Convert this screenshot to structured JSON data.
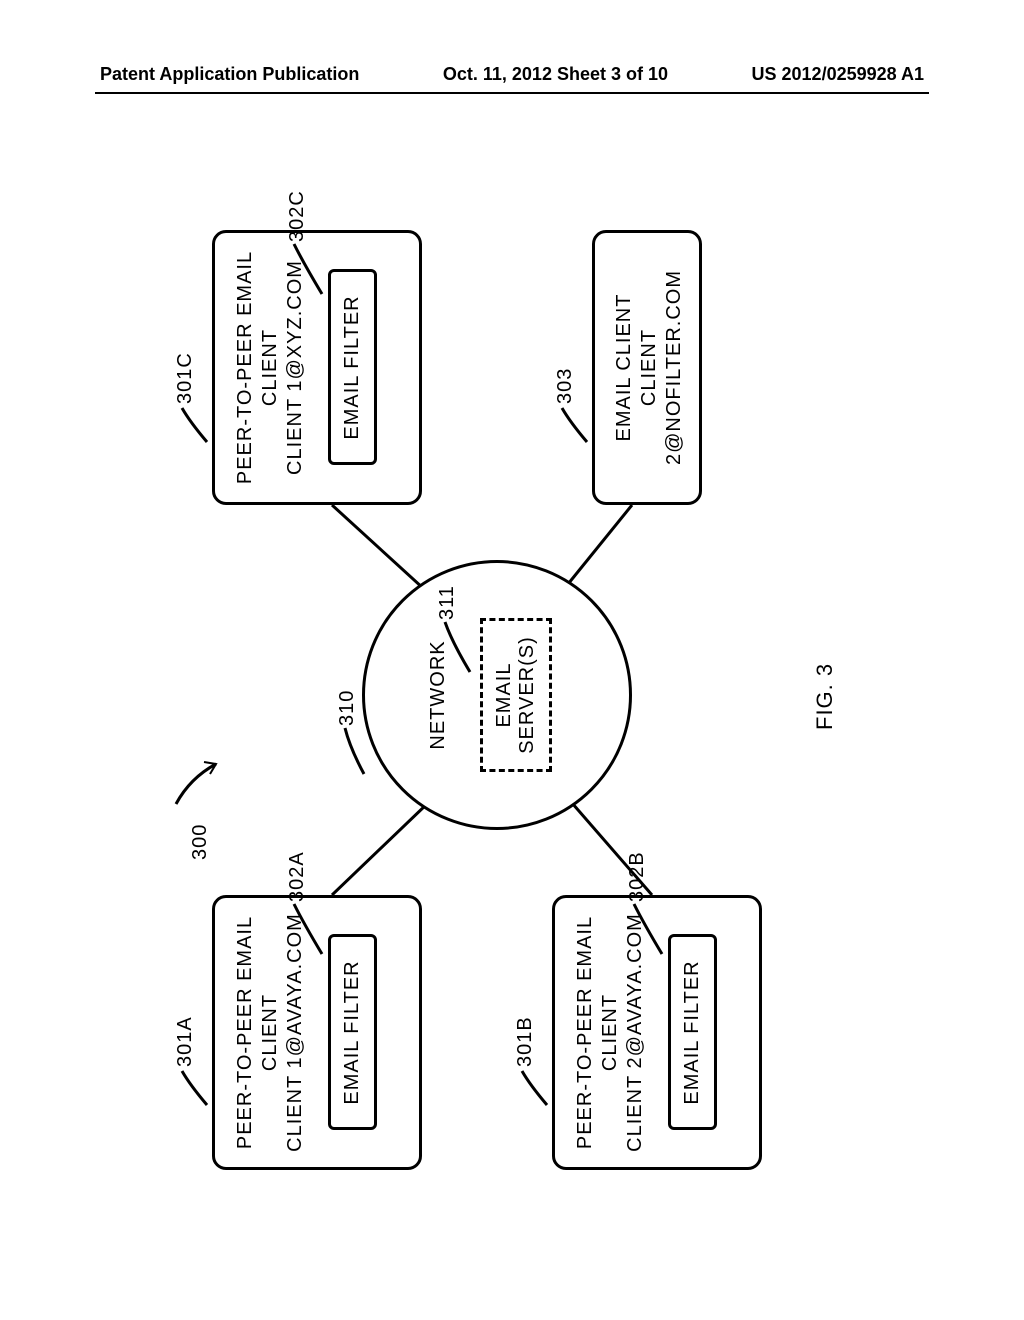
{
  "header": {
    "left": "Patent Application Publication",
    "center": "Oct. 11, 2012  Sheet 3 of 10",
    "right": "US 2012/0259928 A1"
  },
  "figure": {
    "systemRef": "300",
    "networkRef": "310",
    "networkLabel": "NETWORK",
    "serverRef": "311",
    "serverLabel": "EMAIL SERVER(S)",
    "figLabel": "FIG. 3",
    "boxes": {
      "a": {
        "ref": "301A",
        "line1": "PEER-TO-PEER EMAIL",
        "line2": "CLIENT",
        "line3": "CLIENT 1@AVAYA.COM",
        "filterRef": "302A",
        "filterLabel": "EMAIL FILTER"
      },
      "b": {
        "ref": "301B",
        "line1": "PEER-TO-PEER EMAIL",
        "line2": "CLIENT",
        "line3": "CLIENT 2@AVAYA.COM",
        "filterRef": "302B",
        "filterLabel": "EMAIL FILTER"
      },
      "c": {
        "ref": "301C",
        "line1": "PEER-TO-PEER EMAIL",
        "line2": "CLIENT",
        "line3": "CLIENT 1@XYZ.COM",
        "filterRef": "302C",
        "filterLabel": "EMAIL FILTER"
      },
      "d": {
        "ref": "303",
        "line1": "EMAIL CLIENT",
        "line2": "CLIENT 2@NOFILTER.COM"
      }
    }
  }
}
